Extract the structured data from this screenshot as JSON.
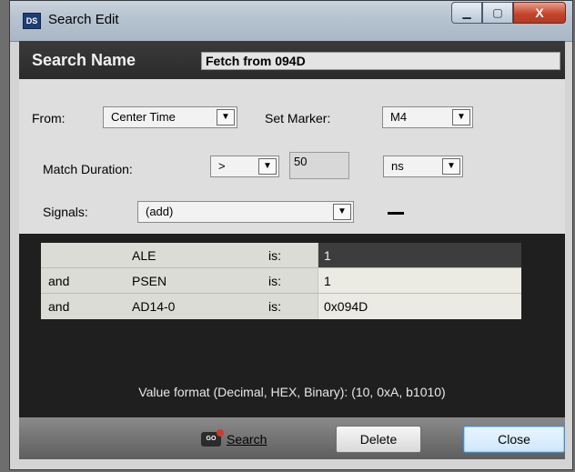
{
  "window": {
    "icon_text": "DS",
    "title": "Search Edit",
    "minimize_glyph": "▁",
    "maximize_glyph": "▢",
    "close_glyph": "X"
  },
  "search_name": {
    "label": "Search Name",
    "value": "Fetch from 094D"
  },
  "form": {
    "from_label": "From:",
    "from_value": "Center Time",
    "set_marker_label": "Set Marker:",
    "set_marker_value": "M4",
    "match_duration_label": "Match Duration:",
    "match_operator": ">",
    "match_value": "50",
    "match_unit": "ns",
    "signals_label": "Signals:",
    "signals_value": "(add)",
    "dropdown_glyph": "▼"
  },
  "signals": [
    {
      "conj": "",
      "name": "ALE",
      "is": "is:",
      "value": "1"
    },
    {
      "conj": "and",
      "name": "PSEN",
      "is": "is:",
      "value": "1"
    },
    {
      "conj": "and",
      "name": "AD14-0",
      "is": "is:",
      "value": "0x094D"
    }
  ],
  "value_format_text": "Value format (Decimal, HEX, Binary):  (10, 0xA, b1010)",
  "buttons": {
    "search_icon_text": "GO",
    "search_label": "Search",
    "delete_label": "Delete",
    "close_label": "Close"
  }
}
